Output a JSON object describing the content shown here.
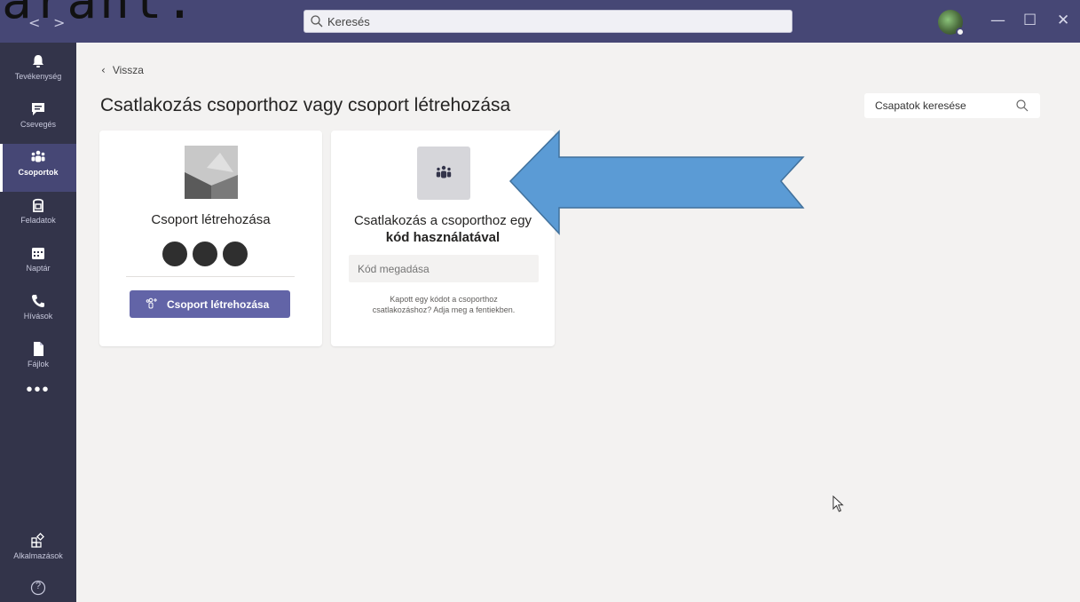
{
  "overlay_text": "arant.",
  "titlebar": {
    "back_glyph": "<",
    "forward_glyph": ">",
    "search_placeholder": "Keresés",
    "minimize_glyph": "—",
    "maximize_glyph": "☐",
    "close_glyph": "✕"
  },
  "rail": {
    "items": [
      {
        "label": "Tevékenység",
        "icon": "bell-icon"
      },
      {
        "label": "Csevegés",
        "icon": "chat-icon"
      },
      {
        "label": "Csoportok",
        "icon": "teams-icon"
      },
      {
        "label": "Feladatok",
        "icon": "assignments-icon"
      },
      {
        "label": "Naptár",
        "icon": "calendar-icon"
      },
      {
        "label": "Hívások",
        "icon": "phone-icon"
      },
      {
        "label": "Fájlok",
        "icon": "file-icon"
      }
    ],
    "more_label": "•••",
    "apps_label": "Alkalmazások",
    "help_glyph": "?",
    "active_index": 2
  },
  "main": {
    "back_label": "Vissza",
    "page_title": "Csatlakozás csoporthoz vagy csoport létrehozása",
    "teams_search_placeholder": "Csapatok keresése"
  },
  "create_card": {
    "title": "Csoport létrehozása",
    "button_label": "Csoport létrehozása"
  },
  "join_card": {
    "title_line1": "Csatlakozás a csoporthoz egy",
    "title_line2": "kód használatával",
    "input_placeholder": "Kód megadása",
    "help_line1": "Kapott egy kódot a csoporthoz",
    "help_line2": "csatlakozáshoz? Adja meg a fentiekben."
  },
  "colors": {
    "titlebar": "#464775",
    "rail": "#33344a",
    "accent": "#6264a7",
    "arrow_fill": "#5b9bd5",
    "arrow_stroke": "#41719c"
  }
}
